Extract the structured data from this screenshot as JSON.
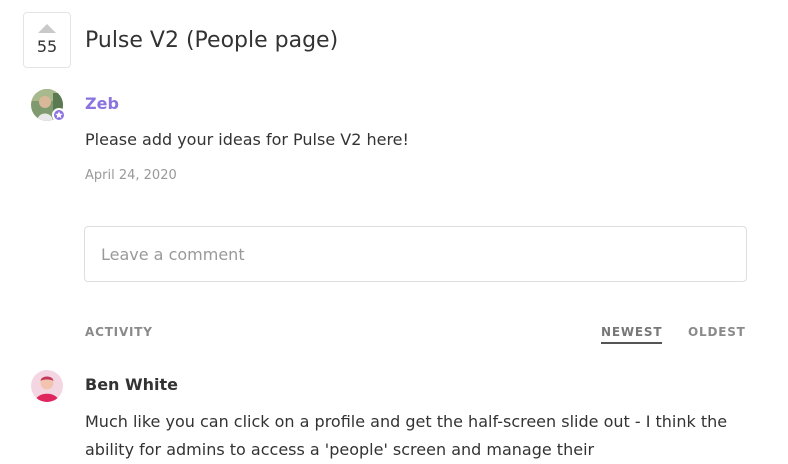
{
  "post": {
    "vote_count": "55",
    "title": "Pulse V2 (People page)",
    "author": "Zeb",
    "body": "Please add your ideas for Pulse V2 here!",
    "date": "April 24, 2020"
  },
  "comment_box": {
    "placeholder": "Leave a comment"
  },
  "activity": {
    "label": "ACTIVITY",
    "sort_newest": "NEWEST",
    "sort_oldest": "OLDEST"
  },
  "comments": [
    {
      "author": "Ben White",
      "body": "Much like you can click on a profile and get the half-screen slide out - I think the ability for admins to access a 'people' screen and manage their"
    }
  ],
  "colors": {
    "admin_accent": "#8b73e0",
    "text": "#333333",
    "muted": "#999999"
  }
}
